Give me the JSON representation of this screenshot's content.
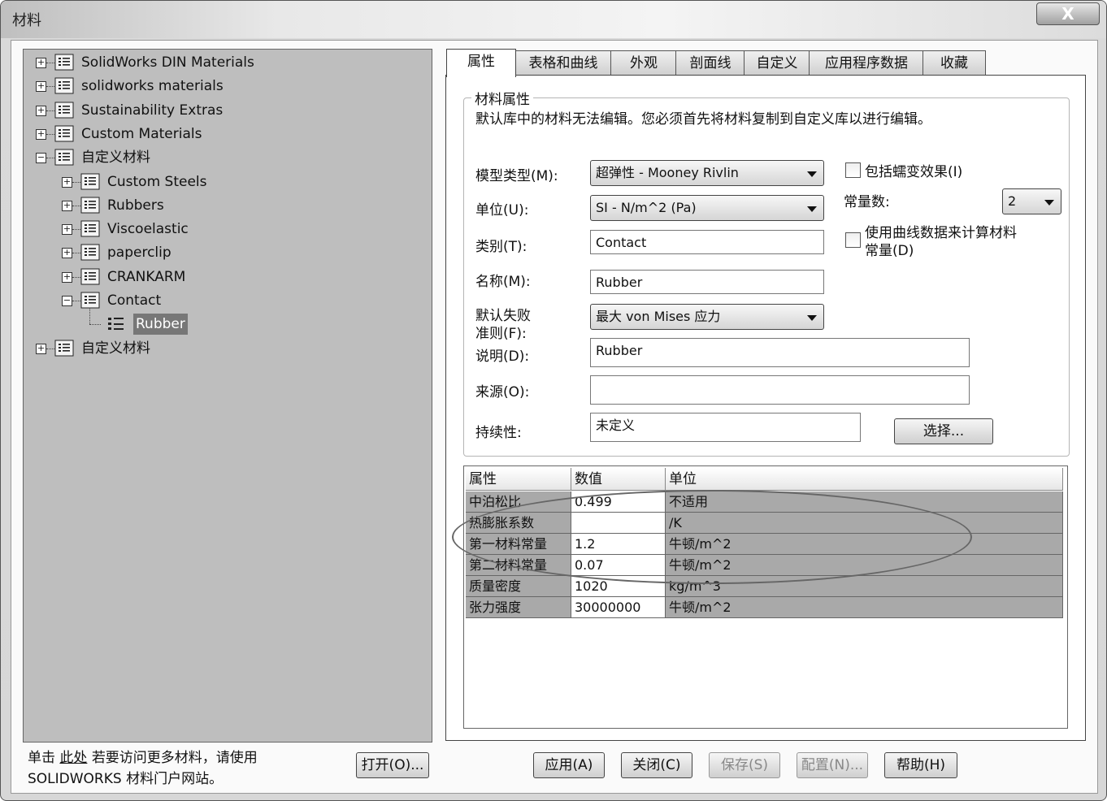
{
  "window": {
    "title": "材料",
    "close_label": "X"
  },
  "tree": [
    {
      "label": "SolidWorks DIN Materials",
      "expander": "+"
    },
    {
      "label": "solidworks materials",
      "expander": "+"
    },
    {
      "label": "Sustainability Extras",
      "expander": "+"
    },
    {
      "label": "Custom Materials",
      "expander": "+"
    },
    {
      "label": "自定义材料",
      "expander": "−"
    },
    {
      "label": "Custom Steels",
      "expander": "+"
    },
    {
      "label": "Rubbers",
      "expander": "+"
    },
    {
      "label": "Viscoelastic",
      "expander": "+"
    },
    {
      "label": "paperclip",
      "expander": "+"
    },
    {
      "label": "CRANKARM",
      "expander": "+"
    },
    {
      "label": "Contact",
      "expander": "−"
    },
    {
      "label": "Rubber",
      "selected": true
    },
    {
      "label": "自定义材料",
      "expander": "+"
    }
  ],
  "footer_left": {
    "prefix": "单击",
    "link": "此处",
    "suffix": "若要访问更多材料，请使用",
    "line2": "SOLIDWORKS 材料门户网站。",
    "open_button": "打开(O)..."
  },
  "tabs": [
    "属性",
    "表格和曲线",
    "外观",
    "剖面线",
    "自定义",
    "应用程序数据",
    "收藏"
  ],
  "properties": {
    "group_title": "材料属性",
    "notice": "默认库中的材料无法编辑。您必须首先将材料复制到自定义库以进行编辑。",
    "model_type_label": "模型类型(M):",
    "model_type_value": "超弹性 - Mooney Rivlin",
    "unit_label": "单位(U):",
    "unit_value": "SI - N/m^2 (Pa)",
    "category_label": "类别(T):",
    "category_value": "Contact",
    "name_label": "名称(M):",
    "name_value": "Rubber",
    "failure_label_1": "默认失败",
    "failure_label_2": "准则(F):",
    "failure_value": "最大 von Mises 应力",
    "description_label": "说明(D):",
    "description_value": "Rubber",
    "source_label": "来源(O):",
    "source_value": "",
    "sustainability_label": "持续性:",
    "sustainability_value": "未定义",
    "select_button": "选择...",
    "creep_label": "包括蠕变效果(I)",
    "constants_label": "常量数:",
    "constants_value": "2",
    "curve_label_1": "使用曲线数据来计算材料",
    "curve_label_2": "常量(D)"
  },
  "table": {
    "headers": [
      "属性",
      "数值",
      "单位"
    ],
    "rows": [
      {
        "property": "中泊松比",
        "value": "0.499",
        "unit": "不适用"
      },
      {
        "property": "热膨胀系数",
        "value": "",
        "unit": "/K"
      },
      {
        "property": "第一材料常量",
        "value": "1.2",
        "unit": "牛顿/m^2"
      },
      {
        "property": "第二材料常量",
        "value": "0.07",
        "unit": "牛顿/m^2"
      },
      {
        "property": "质量密度",
        "value": "1020",
        "unit": "kg/m^3"
      },
      {
        "property": "张力强度",
        "value": "30000000",
        "unit": "牛顿/m^2"
      }
    ]
  },
  "buttons": {
    "apply": "应用(A)",
    "close": "关闭(C)",
    "save": "保存(S)",
    "config": "配置(N)...",
    "help": "帮助(H)"
  }
}
